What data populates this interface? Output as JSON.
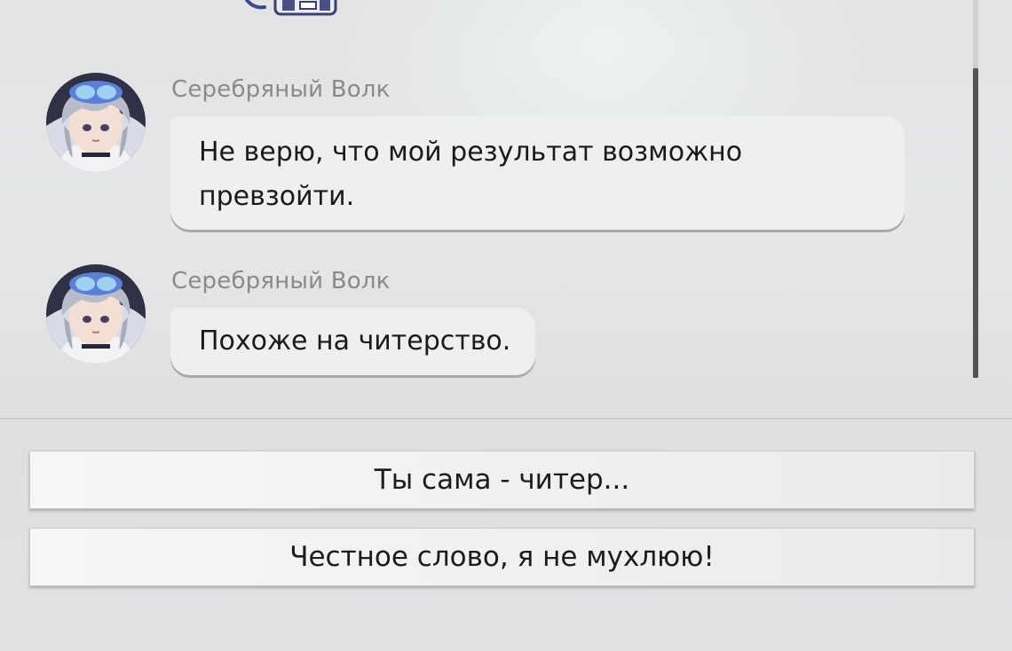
{
  "chat": {
    "messages": [
      {
        "sender": "Серебряный Волк",
        "text_lines": [
          "Не верю, что мой результат возможно",
          "превзойти."
        ],
        "avatar_icon": "silver-wolf-avatar-icon"
      },
      {
        "sender": "Серебряный Волк",
        "text": "Похоже на читерство.",
        "avatar_icon": "silver-wolf-avatar-icon"
      }
    ]
  },
  "reply_options": [
    {
      "label": "Ты сама - читер..."
    },
    {
      "label": "Честное слово, я не мухлюю!"
    }
  ],
  "colors": {
    "bubble_bg": "#efefef",
    "sender_name": "#8a8a8a",
    "scroll_thumb": "#545454",
    "avatar_hair": "#b8bcc8",
    "avatar_goggles": "#5b7fd6"
  }
}
